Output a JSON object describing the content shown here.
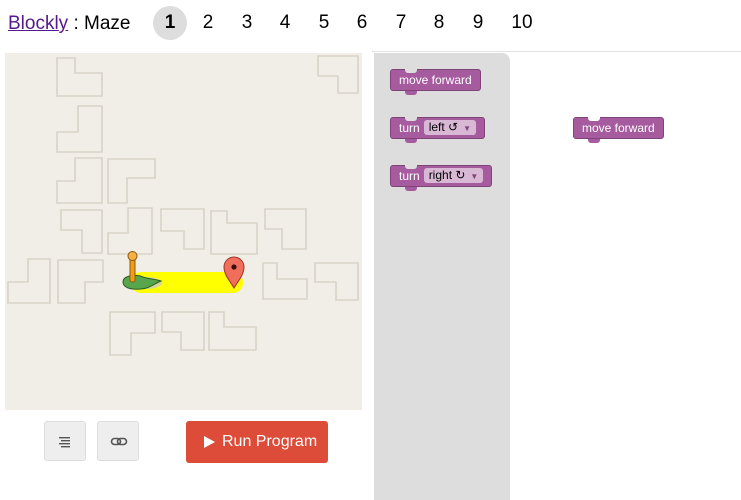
{
  "header": {
    "app_link": "Blockly",
    "separator": " : ",
    "title": "Maze",
    "levels": [
      "1",
      "2",
      "3",
      "4",
      "5",
      "6",
      "7",
      "8",
      "9",
      "10"
    ],
    "active_level": "1"
  },
  "controls": {
    "code_icon": "code-lines-icon",
    "link_icon": "link-icon",
    "run_label": "Run Program",
    "run_color": "#dd4b39"
  },
  "toolbox": {
    "move_forward": "move forward",
    "turn_left": {
      "label": "turn",
      "value": "left ↺"
    },
    "turn_right": {
      "label": "turn",
      "value": "right ↻"
    }
  },
  "workspace": {
    "block_label": "move forward"
  },
  "colors": {
    "block": "#a55b9e",
    "path": "#ffff00",
    "maze_bg": "#f1eee7",
    "flyout_bg": "#dddddd"
  }
}
